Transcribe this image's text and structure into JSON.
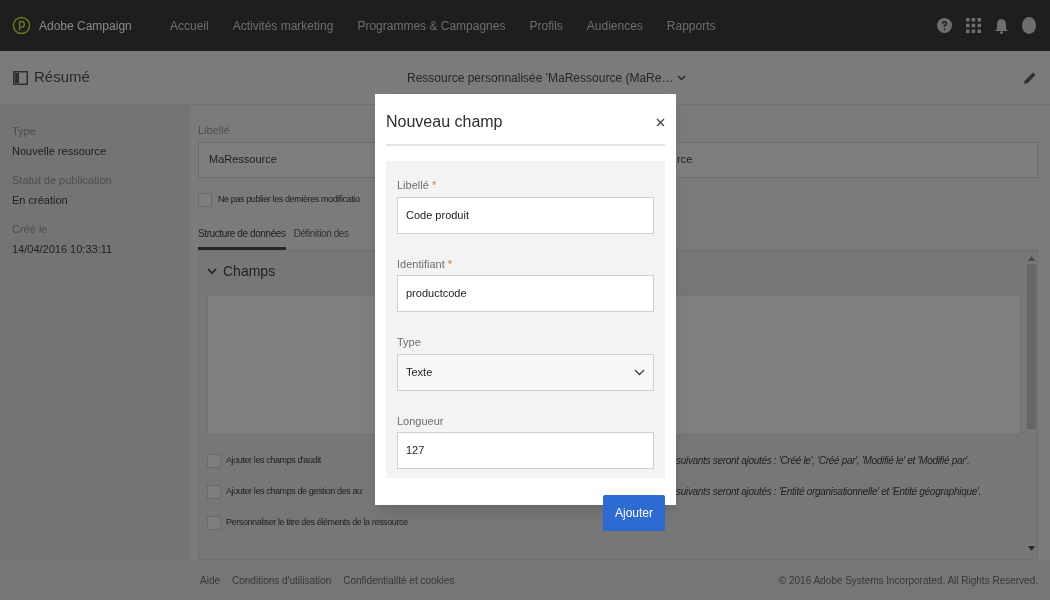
{
  "app": {
    "name": "Adobe Campaign"
  },
  "nav": [
    {
      "label": "Accueil"
    },
    {
      "label": "Activités marketing"
    },
    {
      "label": "Programmes & Campagnes"
    },
    {
      "label": "Profils"
    },
    {
      "label": "Audiences"
    },
    {
      "label": "Rapports"
    }
  ],
  "header": {
    "summary_title": "Résumé",
    "resource_title": "Ressource personnalisée 'MaRessource (MaRe…"
  },
  "sidebar": [
    {
      "label": "Type",
      "value": "Nouvelle ressource"
    },
    {
      "label": "Statut de publication",
      "value": "En création"
    },
    {
      "label": "Créé le",
      "value": "14/04/2016 10:33:11"
    }
  ],
  "form": {
    "label": "Libellé",
    "value": "MaRessource",
    "second_value": "rce",
    "checkbox": {
      "label": "Ne pas publier les dernières modificatio",
      "checked": false
    }
  },
  "tabs": [
    {
      "label": "Structure de données",
      "selected": true
    },
    {
      "label": "Définition des",
      "selected": false
    }
  ],
  "section": {
    "title": "Champs",
    "expanded": true
  },
  "options": [
    {
      "label": "Ajouter les champs d'audit",
      "note": "suivants seront ajoutés : 'Créé le', 'Créé par', 'Modifié le' et 'Modifié par'.",
      "checked": false
    },
    {
      "label": "Ajouter les champs de gestion des au",
      "note": "suivants seront ajoutés : 'Entité organisationnelle' et 'Entité géographique'.",
      "checked": false
    },
    {
      "label": "Personnaliser le titre des éléments de la ressource",
      "checked": false
    }
  ],
  "footer": {
    "links": [
      "Aide",
      "Conditions d'utilisation",
      "Confidentialité et cookies"
    ],
    "copyright": "© 2016 Adobe Systems Incorporated. All Rights Reserved."
  },
  "modal": {
    "title": "Nouveau champ",
    "fields": [
      {
        "kind": "text",
        "label": "Libellé",
        "required_mark": "*",
        "value": "Code produit"
      },
      {
        "kind": "text",
        "label": "Identifiant",
        "required_mark": "*",
        "value": "productcode"
      },
      {
        "kind": "select",
        "label": "Type",
        "value": "Texte"
      },
      {
        "kind": "text",
        "label": "Longueur",
        "value": "127"
      }
    ],
    "button": "Ajouter"
  }
}
